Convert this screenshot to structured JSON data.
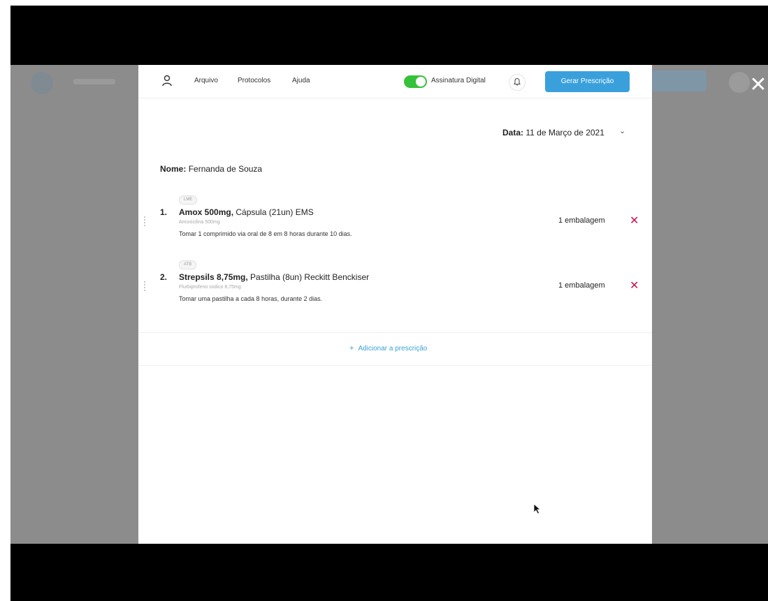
{
  "topbar": {
    "nav": [
      "Arquivo",
      "Protocolos",
      "Ajuda"
    ],
    "toggle_label": "Assinatura Digital",
    "toggle_on": true,
    "primary_button": "Gerar Prescrição"
  },
  "date": {
    "label": "Data:",
    "value": "11 de Março de 2021"
  },
  "patient": {
    "label": "Nome:",
    "value": "Fernanda de Souza"
  },
  "items": [
    {
      "tag": "LME",
      "number": "1.",
      "name": "Amox 500mg,",
      "detail": " Cápsula (21un) EMS",
      "generic": "Amoxicilina 500mg",
      "instructions": "Tomar 1 comprimido via oral de 8 em 8 horas durante 10 dias.",
      "quantity": "1 embalagem"
    },
    {
      "tag": "ATB",
      "number": "2.",
      "name": "Strepsils 8,75mg,",
      "detail": " Pastilha (8un) Reckitt Benckiser",
      "generic": "Flurbiprofeno sodico 8,75mg",
      "instructions": "Tomar uma pastilha a cada 8 horas, durante 2 dias.",
      "quantity": "1 embalagem"
    }
  ],
  "add_link": "Adicionar a prescrição",
  "colors": {
    "accent": "#3aa0dc",
    "toggle": "#35c23a",
    "remove": "#c4124f",
    "backdrop": "#8c8c8c"
  },
  "icons": [
    "user-icon",
    "bell-icon",
    "chevron-down-icon",
    "close-icon",
    "remove-icon",
    "plus-icon",
    "cursor-icon"
  ]
}
